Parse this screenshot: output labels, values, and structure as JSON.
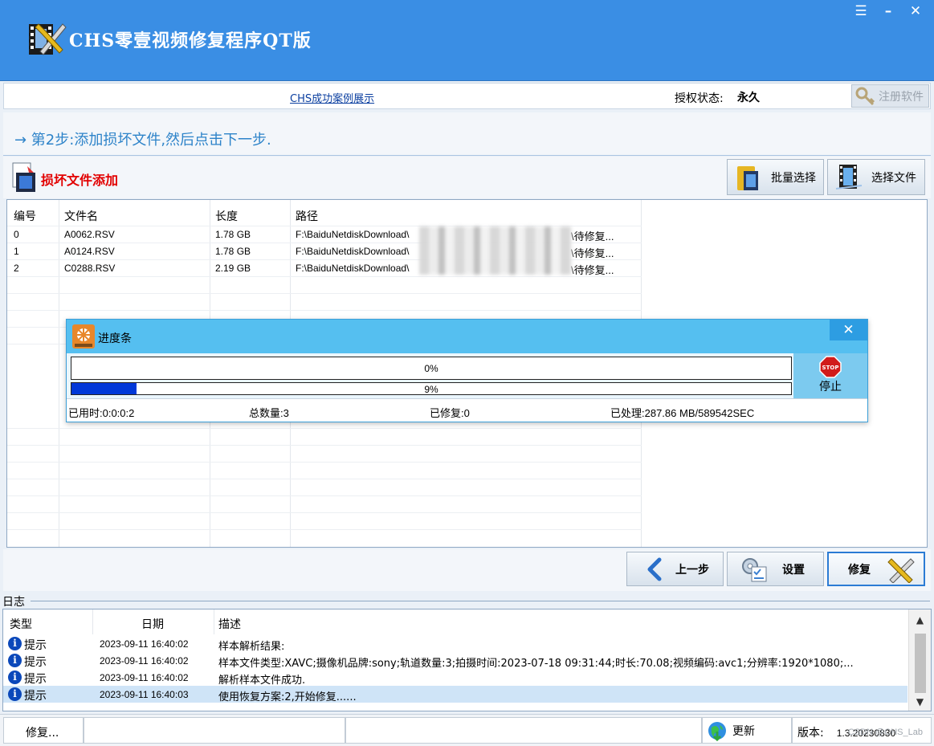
{
  "window": {
    "title": "CHS零壹视频修复程序QT版",
    "controls": [
      "☰",
      "–",
      "✕"
    ]
  },
  "infobar": {
    "case_link": "CHS成功案例展示",
    "auth_label": "授权状态:",
    "auth_value": "永久",
    "register_label": "注册软件"
  },
  "step": {
    "text": "→ 第2步:添加损坏文件,然后点击下一步."
  },
  "file_section": {
    "title": "损坏文件添加",
    "batch_select_label": "批量选择",
    "select_file_label": "选择文件",
    "columns": [
      "编号",
      "文件名",
      "长度",
      "路径"
    ],
    "rows": [
      {
        "id": "0",
        "name": "A0062.RSV",
        "size": "1.78 GB",
        "path_start": "F:\\BaiduNetdiskDownload\\",
        "path_end": "\\待修复..."
      },
      {
        "id": "1",
        "name": "A0124.RSV",
        "size": "1.78 GB",
        "path_start": "F:\\BaiduNetdiskDownload\\",
        "path_end": "\\待修复..."
      },
      {
        "id": "2",
        "name": "C0288.RSV",
        "size": "2.19 GB",
        "path_start": "F:\\BaiduNetdiskDownload\\",
        "path_end": "\\待修复..."
      }
    ]
  },
  "progress_dialog": {
    "title": "进度条",
    "close": "✕",
    "bar1_label": "0%",
    "bar1_fraction": 0.0,
    "bar2_label": "9%",
    "bar2_fraction": 0.09,
    "stop_label": "停止",
    "stats": {
      "elapsed": "已用时:0:0:0:2",
      "total": "总数量:3",
      "repaired": "已修复:0",
      "processed": "已处理:287.86 MB/589542SEC"
    }
  },
  "nav": {
    "prev_label": "上一步",
    "settings_label": "设置",
    "repair_label": "修复"
  },
  "log": {
    "label": "日志",
    "columns": [
      "类型",
      "日期",
      "描述"
    ],
    "rows": [
      {
        "type": "提示",
        "date": "2023-09-11 16:40:02",
        "desc": "样本解析结果:"
      },
      {
        "type": "提示",
        "date": "2023-09-11 16:40:02",
        "desc": "样本文件类型:XAVC;摄像机品牌:sony;轨道数量:3;拍摄时间:2023-07-18 09:31:44;时长:70.08;视频编码:avc1;分辨率:1920*1080;..."
      },
      {
        "type": "提示",
        "date": "2023-09-11 16:40:02",
        "desc": "解析样本文件成功."
      },
      {
        "type": "提示",
        "date": "2023-09-11 16:40:03",
        "desc": "使用恢复方案:2,开始修复......"
      }
    ]
  },
  "statusbar": {
    "status": "修复...",
    "update_label": "更新",
    "version_label": "版本:",
    "version_value": "1.3.20230830"
  },
  "watermark": "CSDN @CHS_Lab",
  "colors": {
    "titlebar": "#3a8ee4",
    "step_text": "#2d83c9",
    "section_title": "#e20000",
    "progress_fill": "#0038d8",
    "dialog_header": "#55bff0"
  }
}
